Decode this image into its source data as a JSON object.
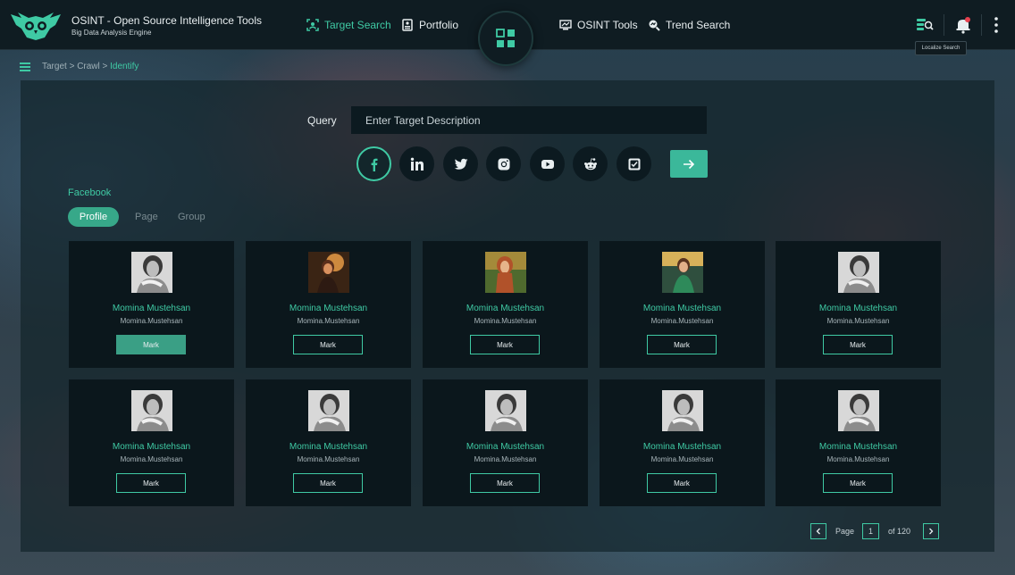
{
  "app": {
    "title": "OSINT - Open Source Intelligence Tools",
    "subtitle": "Big Data Analysis Engine"
  },
  "nav": [
    {
      "label": "Target Search",
      "icon": "target-search-icon",
      "active": true
    },
    {
      "label": "Portfolio",
      "icon": "portfolio-icon",
      "active": false
    },
    {
      "label": "OSINT Tools",
      "icon": "osint-tools-icon",
      "active": false
    },
    {
      "label": "Trend Search",
      "icon": "trend-search-icon",
      "active": false
    }
  ],
  "toolbar": {
    "tooltip": "Localize Search"
  },
  "breadcrumb": {
    "path": "Target > Crawl > ",
    "current": "Identify"
  },
  "query": {
    "label": "Query",
    "placeholder": "Enter Target Description"
  },
  "platforms": [
    "facebook",
    "linkedin",
    "twitter",
    "instagram",
    "youtube",
    "reddit",
    "other"
  ],
  "section": {
    "title": "Facebook",
    "tabs": [
      "Profile",
      "Page",
      "Group"
    ],
    "active_tab": "Profile"
  },
  "cards": [
    {
      "name": "Momina Mustehsan",
      "username": "Momina.Mustehsan",
      "button": "Mark",
      "marked": true,
      "photo": "bw"
    },
    {
      "name": "Momina Mustehsan",
      "username": "Momina.Mustehsan",
      "button": "Mark",
      "marked": false,
      "photo": "sunset"
    },
    {
      "name": "Momina Mustehsan",
      "username": "Momina.Mustehsan",
      "button": "Mark",
      "marked": false,
      "photo": "autumn"
    },
    {
      "name": "Momina Mustehsan",
      "username": "Momina.Mustehsan",
      "button": "Mark",
      "marked": false,
      "photo": "green"
    },
    {
      "name": "Momina Mustehsan",
      "username": "Momina.Mustehsan",
      "button": "Mark",
      "marked": false,
      "photo": "bw"
    },
    {
      "name": "Momina Mustehsan",
      "username": "Momina.Mustehsan",
      "button": "Mark",
      "marked": false,
      "photo": "bw"
    },
    {
      "name": "Momina Mustehsan",
      "username": "Momina.Mustehsan",
      "button": "Mark",
      "marked": false,
      "photo": "bw"
    },
    {
      "name": "Momina Mustehsan",
      "username": "Momina.Mustehsan",
      "button": "Mark",
      "marked": false,
      "photo": "bw"
    },
    {
      "name": "Momina Mustehsan",
      "username": "Momina.Mustehsan",
      "button": "Mark",
      "marked": false,
      "photo": "bw"
    },
    {
      "name": "Momina Mustehsan",
      "username": "Momina.Mustehsan",
      "button": "Mark",
      "marked": false,
      "photo": "bw"
    }
  ],
  "pagination": {
    "page_label": "Page",
    "current": "1",
    "of_label": "of 120"
  },
  "colors": {
    "accent": "#3fcaa4",
    "topbar": "#0f1c22",
    "card": "#0b171c",
    "notification": "#e8414f"
  }
}
